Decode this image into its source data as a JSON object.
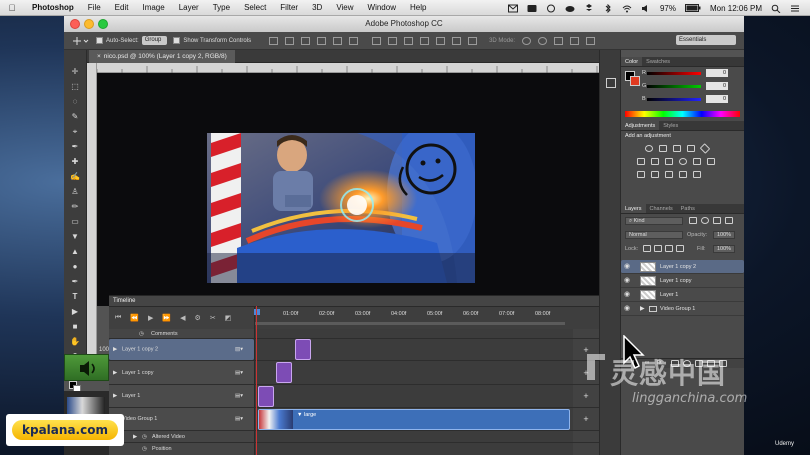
{
  "menubar": {
    "app": "Photoshop",
    "items": [
      "File",
      "Edit",
      "Image",
      "Layer",
      "Type",
      "Select",
      "Filter",
      "3D",
      "View",
      "Window",
      "Help"
    ],
    "battery": "97%",
    "clock": "Mon 12:06 PM"
  },
  "window": {
    "title": "Adobe Photoshop CC",
    "workspace": "Essentials"
  },
  "options": {
    "auto_select_label": "Auto-Select:",
    "auto_select_value": "Group",
    "transform_label": "Show Transform Controls",
    "mode_3d": "3D Mode:"
  },
  "document": {
    "tab": "nico.psd @ 100% (Layer 1 copy 2, RGB/8)",
    "zoom": "100"
  },
  "timeline": {
    "title": "Timeline",
    "ticks": [
      "01:00f",
      "02:00f",
      "03:00f",
      "04:00f",
      "05:00f",
      "06:00f",
      "07:00f",
      "08:00f"
    ],
    "rows": {
      "comments": "Comments",
      "layer1copy2": "Layer 1 copy 2",
      "layer1copy": "Layer 1 copy",
      "layer1": "Layer 1",
      "videogroup": "Video Group 1",
      "altered": "Altered Video",
      "position": "Position"
    },
    "video_clip": "large"
  },
  "panels": {
    "color_tabs": [
      "Color",
      "Swatches"
    ],
    "channels": [
      {
        "label": "R",
        "value": "0"
      },
      {
        "label": "G",
        "value": "0"
      },
      {
        "label": "B",
        "value": "0"
      }
    ],
    "adj_tabs": [
      "Adjustments",
      "Styles"
    ],
    "adj_title": "Add an adjustment",
    "layers_tabs": [
      "Layers",
      "Channels",
      "Paths"
    ],
    "kind": "Kind",
    "blend": "Normal",
    "opacity_label": "Opacity:",
    "opacity": "100%",
    "lock_label": "Lock:",
    "fill_label": "Fill:",
    "fill": "100%",
    "layers": [
      "Layer 1 copy 2",
      "Layer 1 copy",
      "Layer 1",
      "Video Group 1"
    ]
  },
  "overlays": {
    "site_badge": "kpalana.com",
    "watermark_cn": "灵感中国",
    "watermark_en": "lingganchina.com",
    "udemy": "Udemy"
  },
  "colors": {
    "accent_selected_row": "#5b6c8a",
    "clip_purple": "#7d4cb5",
    "video_clip_blue": "#3d6fb8",
    "fg_swatch": "#000000",
    "bg_swatch": "#e03a20"
  }
}
